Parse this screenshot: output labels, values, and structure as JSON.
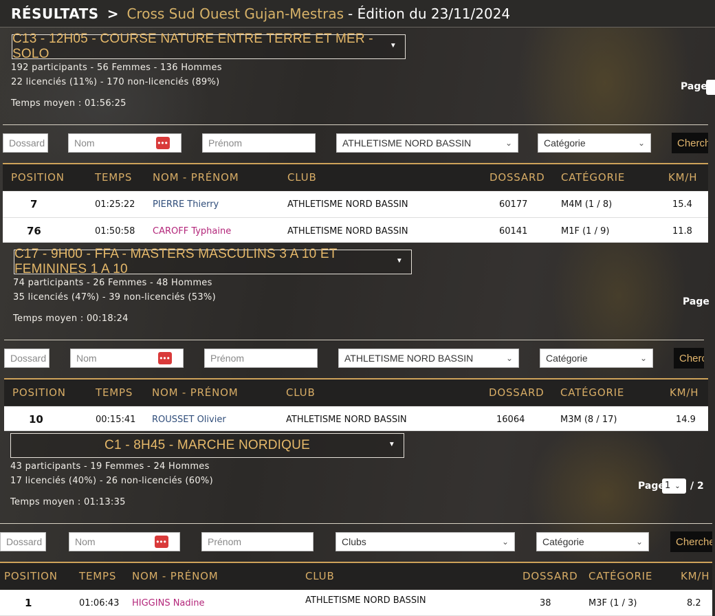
{
  "header": {
    "title": "RÉSULTATS",
    "separator": ">",
    "event": "Cross Sud Ouest Gujan-Mestras",
    "edition": "- Édition du 23/11/2024"
  },
  "colors": {
    "accent": "#d7b268",
    "female": "#b3267a",
    "male": "#2f4d7a"
  },
  "table_headers": [
    "POSITION",
    "TEMPS",
    "NOM - PRÉNOM",
    "CLUB",
    "DOSSARD",
    "CATÉGORIE",
    "KM/H"
  ],
  "filters": {
    "dossard_placeholder": "Dossard",
    "nom_placeholder": "Nom",
    "prenom_placeholder": "Prénom",
    "categorie_placeholder": "Catégorie",
    "search_label": "Chercher"
  },
  "races": [
    {
      "select_label": "C13 - 12H05 - COURSE NATURE ENTRE TERRE ET MER - SOLO",
      "participants": "192 participants - 56 Femmes - 136 Hommes",
      "licences": "22 licenciés (11%) - 170 non-licenciés (89%)",
      "temps_moyen": "Temps moyen : 01:56:25",
      "page_label": "Page",
      "club_filter": "ATHLETISME NORD BASSIN",
      "rows": [
        {
          "position": "7",
          "temps": "01:25:22",
          "nom": "PIERRE Thierry",
          "club": "ATHLETISME NORD BASSIN",
          "dossard": "60177",
          "categorie": "M4M (1 / 8)",
          "kmh": "15.4"
        },
        {
          "position": "76",
          "temps": "01:50:58",
          "nom": "CAROFF Typhaine",
          "club": "ATHLETISME NORD BASSIN",
          "dossard": "60141",
          "categorie": "M1F (1 / 9)",
          "kmh": "11.8"
        }
      ]
    },
    {
      "select_label": "C17 - 9H00 - FFA - MASTERS MASCULINS 3 A 10 ET FEMININES 1 A 10",
      "participants": "74 participants - 26 Femmes - 48 Hommes",
      "licences": "35 licenciés (47%) - 39 non-licenciés (53%)",
      "temps_moyen": "Temps moyen : 00:18:24",
      "page_label": "Page",
      "club_filter": "ATHLETISME NORD BASSIN",
      "rows": [
        {
          "position": "10",
          "temps": "00:15:41",
          "nom": "ROUSSET Olivier",
          "club": "ATHLETISME NORD BASSIN",
          "dossard": "16064",
          "categorie": "M3M (8 / 17)",
          "kmh": "14.9"
        }
      ]
    },
    {
      "select_label": "C1 - 8H45 - MARCHE NORDIQUE",
      "participants": "43 participants - 19 Femmes - 24 Hommes",
      "licences": "17 licenciés (40%) - 26 non-licenciés (60%)",
      "temps_moyen": "Temps moyen : 01:13:35",
      "page_label": "Page",
      "page_value": "1",
      "page_total": "/ 2",
      "club_filter": "Clubs",
      "rows": [
        {
          "position": "1",
          "temps": "01:06:43",
          "nom": "HIGGINS Nadine",
          "club": "ATHLETISME NORD BASSIN",
          "dossard": "38",
          "categorie": "M3F (1 / 3)",
          "kmh": "8.2"
        }
      ]
    }
  ]
}
